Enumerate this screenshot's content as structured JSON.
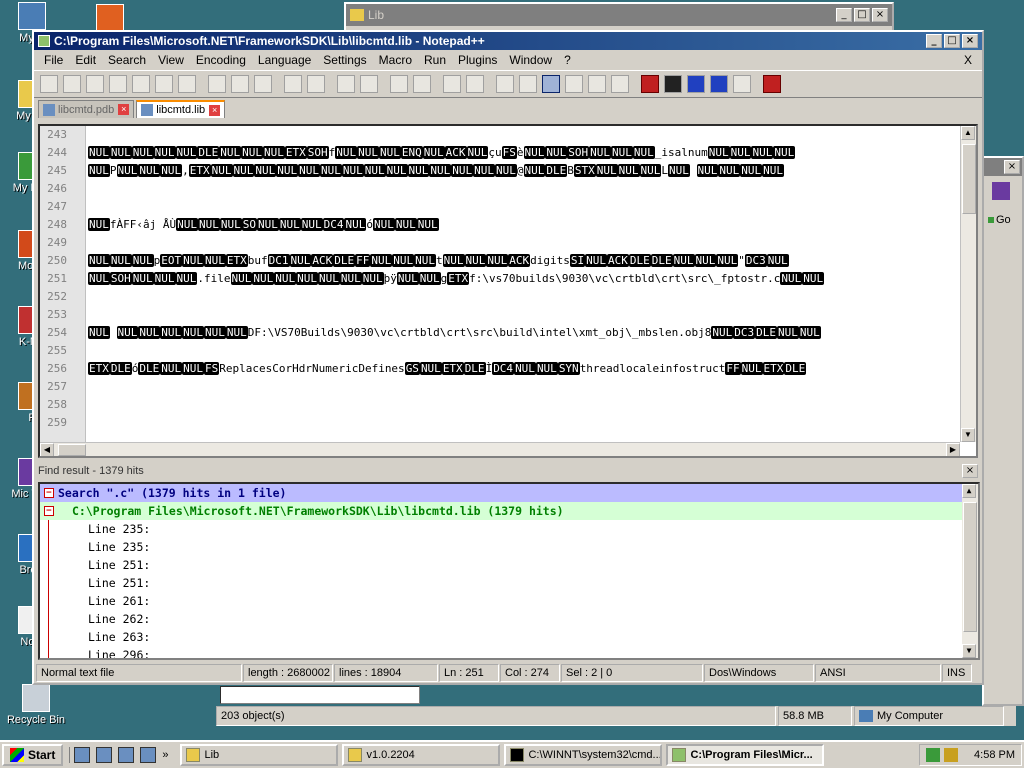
{
  "desktop": {
    "icons": [
      {
        "label": "My C"
      },
      {
        "label": "My Do"
      },
      {
        "label": "My N Pl"
      },
      {
        "label": "Mozill"
      },
      {
        "label": "K-Me"
      },
      {
        "label": "P"
      },
      {
        "label": "Mic Visu"
      },
      {
        "label": "Brow"
      },
      {
        "label": "Note"
      },
      {
        "label": "Recycle Bin"
      }
    ]
  },
  "lib_window": {
    "title": "Lib"
  },
  "npp": {
    "title": "C:\\Program Files\\Microsoft.NET\\FrameworkSDK\\Lib\\libcmtd.lib - Notepad++",
    "menu": [
      "File",
      "Edit",
      "Search",
      "View",
      "Encoding",
      "Language",
      "Settings",
      "Macro",
      "Run",
      "Plugins",
      "Window",
      "?"
    ],
    "menu_close": "X",
    "tabs": [
      {
        "label": "libcmtd.pdb"
      },
      {
        "label": "libcmtd.lib"
      }
    ],
    "line_numbers": [
      "243",
      "244",
      "245",
      "246",
      "247",
      "248",
      "249",
      "250",
      "251",
      "252",
      "253",
      "254",
      "255",
      "256",
      "257",
      "258",
      "259"
    ],
    "lines": [
      [],
      [
        {
          "c": 1,
          "t": "NUL"
        },
        {
          "c": 1,
          "t": "NUL"
        },
        {
          "c": 1,
          "t": "NUL"
        },
        {
          "c": 1,
          "t": "NUL"
        },
        {
          "c": 1,
          "t": "NUL"
        },
        {
          "c": 1,
          "t": "DLE"
        },
        {
          "c": 1,
          "t": "NUL"
        },
        {
          "c": 1,
          "t": "NUL"
        },
        {
          "c": 1,
          "t": "NUL"
        },
        {
          "c": 1,
          "t": "ETX"
        },
        {
          "c": 1,
          "t": "SOH"
        },
        {
          "c": 0,
          "t": "f"
        },
        {
          "c": 1,
          "t": "NUL"
        },
        {
          "c": 1,
          "t": "NUL"
        },
        {
          "c": 1,
          "t": "NUL"
        },
        {
          "c": 1,
          "t": "ENQ"
        },
        {
          "c": 1,
          "t": "NUL"
        },
        {
          "c": 1,
          "t": "ACK"
        },
        {
          "c": 1,
          "t": "NUL"
        },
        {
          "c": 0,
          "t": "çu"
        },
        {
          "c": 1,
          "t": "FS"
        },
        {
          "c": 0,
          "t": "è"
        },
        {
          "c": 1,
          "t": "NUL"
        },
        {
          "c": 1,
          "t": "NUL"
        },
        {
          "c": 1,
          "t": "SOH"
        },
        {
          "c": 1,
          "t": "NUL"
        },
        {
          "c": 1,
          "t": "NUL"
        },
        {
          "c": 1,
          "t": "NUL"
        },
        {
          "c": 0,
          "t": "_isalnum"
        },
        {
          "c": 1,
          "t": "NUL"
        },
        {
          "c": 1,
          "t": "NUL"
        },
        {
          "c": 1,
          "t": "NUL"
        },
        {
          "c": 1,
          "t": "NUL"
        }
      ],
      [
        {
          "c": 1,
          "t": "NUL"
        },
        {
          "c": 0,
          "t": "P"
        },
        {
          "c": 1,
          "t": "NUL"
        },
        {
          "c": 1,
          "t": "NUL"
        },
        {
          "c": 1,
          "t": "NUL"
        },
        {
          "c": 0,
          "t": ","
        },
        {
          "c": 1,
          "t": "ETX"
        },
        {
          "c": 1,
          "t": "NUL"
        },
        {
          "c": 1,
          "t": "NUL"
        },
        {
          "c": 1,
          "t": "NUL"
        },
        {
          "c": 1,
          "t": "NUL"
        },
        {
          "c": 1,
          "t": "NUL"
        },
        {
          "c": 1,
          "t": "NUL"
        },
        {
          "c": 1,
          "t": "NUL"
        },
        {
          "c": 1,
          "t": "NUL"
        },
        {
          "c": 1,
          "t": "NUL"
        },
        {
          "c": 1,
          "t": "NUL"
        },
        {
          "c": 1,
          "t": "NUL"
        },
        {
          "c": 1,
          "t": "NUL"
        },
        {
          "c": 1,
          "t": "NUL"
        },
        {
          "c": 1,
          "t": "NUL"
        },
        {
          "c": 0,
          "t": "@"
        },
        {
          "c": 1,
          "t": "NUL"
        },
        {
          "c": 1,
          "t": "DLE"
        },
        {
          "c": 0,
          "t": "B"
        },
        {
          "c": 1,
          "t": "STX"
        },
        {
          "c": 1,
          "t": "NUL"
        },
        {
          "c": 1,
          "t": "NUL"
        },
        {
          "c": 1,
          "t": "NUL"
        },
        {
          "c": 0,
          "t": "L"
        },
        {
          "c": 1,
          "t": "NUL"
        },
        {
          "c": 0,
          "t": "  "
        },
        {
          "c": 1,
          "t": "NUL"
        },
        {
          "c": 1,
          "t": "NUL"
        },
        {
          "c": 1,
          "t": "NUL"
        },
        {
          "c": 1,
          "t": "NUL"
        }
      ],
      [],
      [],
      [
        {
          "c": 1,
          "t": "NUL"
        },
        {
          "c": 0,
          "t": "fÀFF‹âj ÅÙ"
        },
        {
          "c": 1,
          "t": "NUL"
        },
        {
          "c": 1,
          "t": "NUL"
        },
        {
          "c": 1,
          "t": "NUL"
        },
        {
          "c": 1,
          "t": "SO"
        },
        {
          "c": 1,
          "t": "NUL"
        },
        {
          "c": 1,
          "t": "NUL"
        },
        {
          "c": 1,
          "t": "NUL"
        },
        {
          "c": 1,
          "t": "DC4"
        },
        {
          "c": 1,
          "t": "NUL"
        },
        {
          "c": 0,
          "t": "ó"
        },
        {
          "c": 1,
          "t": "NUL"
        },
        {
          "c": 1,
          "t": "NUL"
        },
        {
          "c": 1,
          "t": "NUL"
        }
      ],
      [],
      [
        {
          "c": 1,
          "t": "NUL"
        },
        {
          "c": 1,
          "t": "NUL"
        },
        {
          "c": 1,
          "t": "NUL"
        },
        {
          "c": 0,
          "t": "p"
        },
        {
          "c": 1,
          "t": "EOT"
        },
        {
          "c": 1,
          "t": "NUL"
        },
        {
          "c": 1,
          "t": "NUL"
        },
        {
          "c": 1,
          "t": "ETX"
        },
        {
          "c": 0,
          "t": "buf"
        },
        {
          "c": 1,
          "t": "DC1"
        },
        {
          "c": 1,
          "t": "NUL"
        },
        {
          "c": 1,
          "t": "ACK"
        },
        {
          "c": 1,
          "t": "DLE"
        },
        {
          "c": 1,
          "t": "FF"
        },
        {
          "c": 1,
          "t": "NUL"
        },
        {
          "c": 1,
          "t": "NUL"
        },
        {
          "c": 1,
          "t": "NUL"
        },
        {
          "c": 0,
          "t": "t"
        },
        {
          "c": 1,
          "t": "NUL"
        },
        {
          "c": 1,
          "t": "NUL"
        },
        {
          "c": 1,
          "t": "NUL"
        },
        {
          "c": 1,
          "t": "ACK"
        },
        {
          "c": 0,
          "t": "digits"
        },
        {
          "c": 1,
          "t": "SI"
        },
        {
          "c": 1,
          "t": "NUL"
        },
        {
          "c": 1,
          "t": "ACK"
        },
        {
          "c": 1,
          "t": "DLE"
        },
        {
          "c": 1,
          "t": "DLE"
        },
        {
          "c": 1,
          "t": "NUL"
        },
        {
          "c": 1,
          "t": "NUL"
        },
        {
          "c": 1,
          "t": "NUL"
        },
        {
          "c": 0,
          "t": "\""
        },
        {
          "c": 1,
          "t": "DC3"
        },
        {
          "c": 1,
          "t": "NUL"
        }
      ],
      [
        {
          "c": 1,
          "t": "NUL"
        },
        {
          "c": 1,
          "t": "SOH"
        },
        {
          "c": 1,
          "t": "NUL"
        },
        {
          "c": 1,
          "t": "NUL"
        },
        {
          "c": 1,
          "t": "NUL"
        },
        {
          "c": 0,
          "t": ".file"
        },
        {
          "c": 1,
          "t": "NUL"
        },
        {
          "c": 1,
          "t": "NUL"
        },
        {
          "c": 1,
          "t": "NUL"
        },
        {
          "c": 1,
          "t": "NUL"
        },
        {
          "c": 1,
          "t": "NUL"
        },
        {
          "c": 1,
          "t": "NUL"
        },
        {
          "c": 1,
          "t": "NUL"
        },
        {
          "c": 0,
          "t": "þÿ"
        },
        {
          "c": 1,
          "t": "NUL"
        },
        {
          "c": 1,
          "t": "NUL"
        },
        {
          "c": 0,
          "t": "g"
        },
        {
          "c": 1,
          "t": "ETX"
        },
        {
          "c": 0,
          "t": "f:\\vs70builds\\9030\\vc\\crtbld\\crt\\src\\_fptostr.c"
        },
        {
          "c": 1,
          "t": "NUL"
        },
        {
          "c": 1,
          "t": "NUL"
        }
      ],
      [],
      [],
      [
        {
          "c": 1,
          "t": "NUL"
        },
        {
          "c": 0,
          "t": "   "
        },
        {
          "c": 1,
          "t": "NUL"
        },
        {
          "c": 1,
          "t": "NUL"
        },
        {
          "c": 1,
          "t": "NUL"
        },
        {
          "c": 1,
          "t": "NUL"
        },
        {
          "c": 1,
          "t": "NUL"
        },
        {
          "c": 1,
          "t": "NUL"
        },
        {
          "c": 0,
          "t": "DF:\\VS70Builds\\9030\\vc\\crtbld\\crt\\src\\build\\intel\\xmt_obj\\_mbslen.obj8"
        },
        {
          "c": 1,
          "t": "NUL"
        },
        {
          "c": 1,
          "t": "DC3"
        },
        {
          "c": 1,
          "t": "DLE"
        },
        {
          "c": 1,
          "t": "NUL"
        },
        {
          "c": 1,
          "t": "NUL"
        }
      ],
      [],
      [
        {
          "c": 1,
          "t": "ETX"
        },
        {
          "c": 1,
          "t": "DLE"
        },
        {
          "c": 0,
          "t": "ó"
        },
        {
          "c": 1,
          "t": "DLE"
        },
        {
          "c": 1,
          "t": "NUL"
        },
        {
          "c": 1,
          "t": "NUL"
        },
        {
          "c": 1,
          "t": "FS"
        },
        {
          "c": 0,
          "t": "ReplacesCorHdrNumericDefines"
        },
        {
          "c": 1,
          "t": "GS"
        },
        {
          "c": 1,
          "t": "NUL"
        },
        {
          "c": 1,
          "t": "ETX"
        },
        {
          "c": 1,
          "t": "DLE"
        },
        {
          "c": 0,
          "t": "Ì"
        },
        {
          "c": 1,
          "t": "DC4"
        },
        {
          "c": 1,
          "t": "NUL"
        },
        {
          "c": 1,
          "t": "NUL"
        },
        {
          "c": 1,
          "t": "SYN"
        },
        {
          "c": 0,
          "t": "threadlocaleinfostruct"
        },
        {
          "c": 1,
          "t": "FF"
        },
        {
          "c": 1,
          "t": "NUL"
        },
        {
          "c": 1,
          "t": "ETX"
        },
        {
          "c": 1,
          "t": "DLE"
        }
      ],
      [],
      [],
      []
    ],
    "find_title": "Find result - 1379 hits",
    "find_search": "Search \".c\" (1379 hits in 1 file)",
    "find_file": "C:\\Program Files\\Microsoft.NET\\FrameworkSDK\\Lib\\libcmtd.lib (1379 hits)",
    "find_hits": [
      "Line 235:",
      "Line 235:",
      "Line 251:",
      "Line 251:",
      "Line 261:",
      "Line 262:",
      "Line 263:",
      "Line 296:"
    ],
    "status": {
      "type": "Normal text file",
      "length": "length : 2680002",
      "lines": "lines : 18904",
      "ln": "Ln : 251",
      "col": "Col : 274",
      "sel": "Sel : 2 | 0",
      "eol": "Dos\\Windows",
      "enc": "ANSI",
      "mode": "INS"
    }
  },
  "explorer_status": {
    "objects": "203 object(s)",
    "size": "58.8 MB",
    "location": "My Computer"
  },
  "right_window": {
    "go": "Go"
  },
  "taskbar": {
    "start": "Start",
    "tasks": [
      "Lib",
      "v1.0.2204",
      "C:\\WINNT\\system32\\cmd....",
      "C:\\Program Files\\Micr..."
    ],
    "clock": "4:58 PM"
  }
}
